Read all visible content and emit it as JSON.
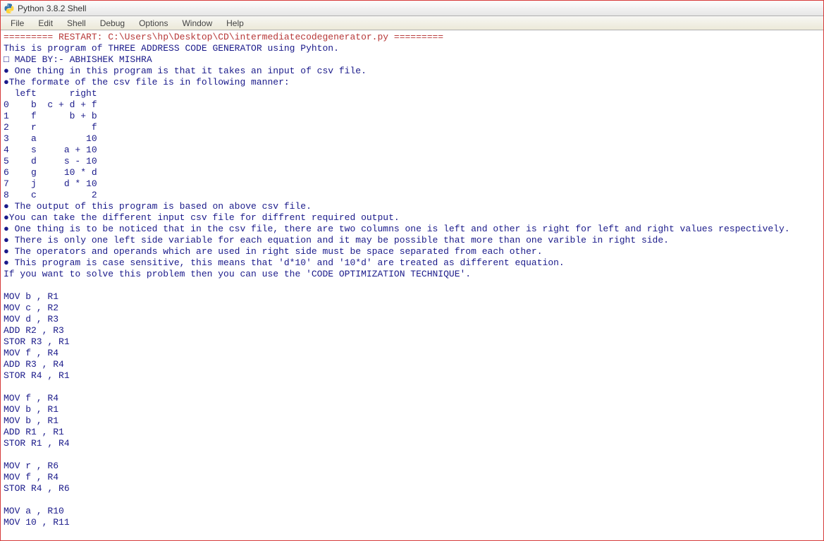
{
  "title": "Python 3.8.2 Shell",
  "menu": {
    "file": "File",
    "edit": "Edit",
    "shell": "Shell",
    "debug": "Debug",
    "options": "Options",
    "window": "Window",
    "help": "Help"
  },
  "output": {
    "restart_line": "========= RESTART: C:\\Users\\hp\\Desktop\\CD\\intermediatecodegenerator.py =========",
    "lines": [
      "This is program of THREE ADDRESS CODE GENERATOR using Pyhton.",
      "□ MADE BY:- ABHISHEK MISHRA",
      "● One thing in this program is that it takes an input of csv file.",
      "●The formate of the csv file is in following manner:",
      "  left      right",
      "0    b  c + d + f",
      "1    f      b + b",
      "2    r          f",
      "3    a         10",
      "4    s     a + 10",
      "5    d     s - 10",
      "6    g     10 * d",
      "7    j     d * 10",
      "8    c          2",
      "● The output of this program is based on above csv file.",
      "●You can take the different input csv file for diffrent required output.",
      "● One thing is to be noticed that in the csv file, there are two columns one is left and other is right for left and right values respectively.",
      "● There is only one left side variable for each equation and it may be possible that more than one varible in right side.",
      "● The operators and operands which are used in right side must be space separated from each other.",
      "● This program is case sensitive, this means that 'd*10' and '10*d' are treated as different equation.",
      "If you want to solve this problem then you can use the 'CODE OPTIMIZATION TECHNIQUE'.",
      "",
      "MOV b , R1",
      "MOV c , R2",
      "MOV d , R3",
      "ADD R2 , R3",
      "STOR R3 , R1",
      "MOV f , R4",
      "ADD R3 , R4",
      "STOR R4 , R1",
      "",
      "MOV f , R4",
      "MOV b , R1",
      "MOV b , R1",
      "ADD R1 , R1",
      "STOR R1 , R4",
      "",
      "MOV r , R6",
      "MOV f , R4",
      "STOR R4 , R6",
      "",
      "MOV a , R10",
      "MOV 10 , R11"
    ]
  }
}
